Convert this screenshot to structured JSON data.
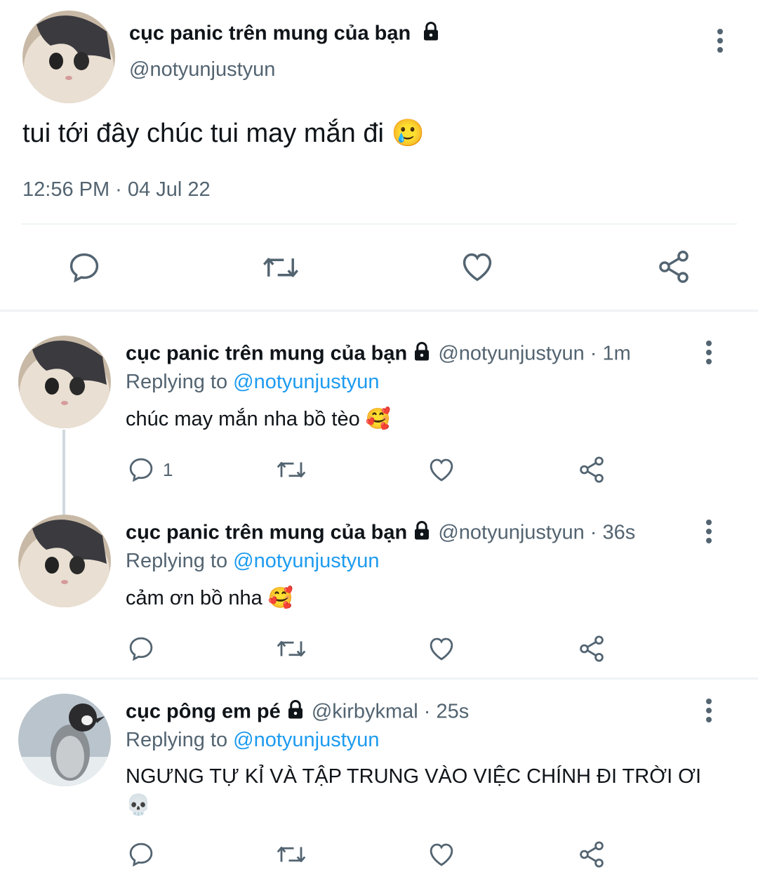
{
  "main_tweet": {
    "display_name": "cục panic trên mung của bạn",
    "handle": "@notyunjustyun",
    "text": "tui tới đây chúc tui may mắn đi 🥲",
    "timestamp": "12:56 PM · 04 Jul 22",
    "icons": {
      "more": "more-vertical-icon",
      "reply": "reply-icon",
      "retweet": "retweet-icon",
      "like": "heart-icon",
      "share": "share-icon",
      "lock": "lock-icon"
    }
  },
  "replies": [
    {
      "display_name": "cục panic trên mung của bạn",
      "handle": "@notyunjustyun",
      "time": "· 1m",
      "replying_label": "Replying to",
      "replying_to": "@notyunjustyun",
      "text": "chúc may mắn nha bồ tèo 🥰",
      "reply_count": "1"
    },
    {
      "display_name": "cục panic trên mung của bạn",
      "handle": "@notyunjustyun",
      "time": "· 36s",
      "replying_label": "Replying to",
      "replying_to": "@notyunjustyun",
      "text": "cảm ơn bồ nha 🥰",
      "reply_count": ""
    },
    {
      "display_name": "cục pông em pé",
      "handle": "@kirbykmal",
      "time": "· 25s",
      "replying_label": "Replying to",
      "replying_to": "@notyunjustyun",
      "text_line1": "NGƯNG TỰ KỈ VÀ TẬP TRUNG VÀO VIỆC CHÍNH ĐI TRỜI ƠI",
      "text_line2": "💀",
      "reply_count": ""
    }
  ],
  "colors": {
    "text": "#0f1419",
    "muted": "#536471",
    "link": "#1d9bf0",
    "divider": "#eff3f4"
  }
}
